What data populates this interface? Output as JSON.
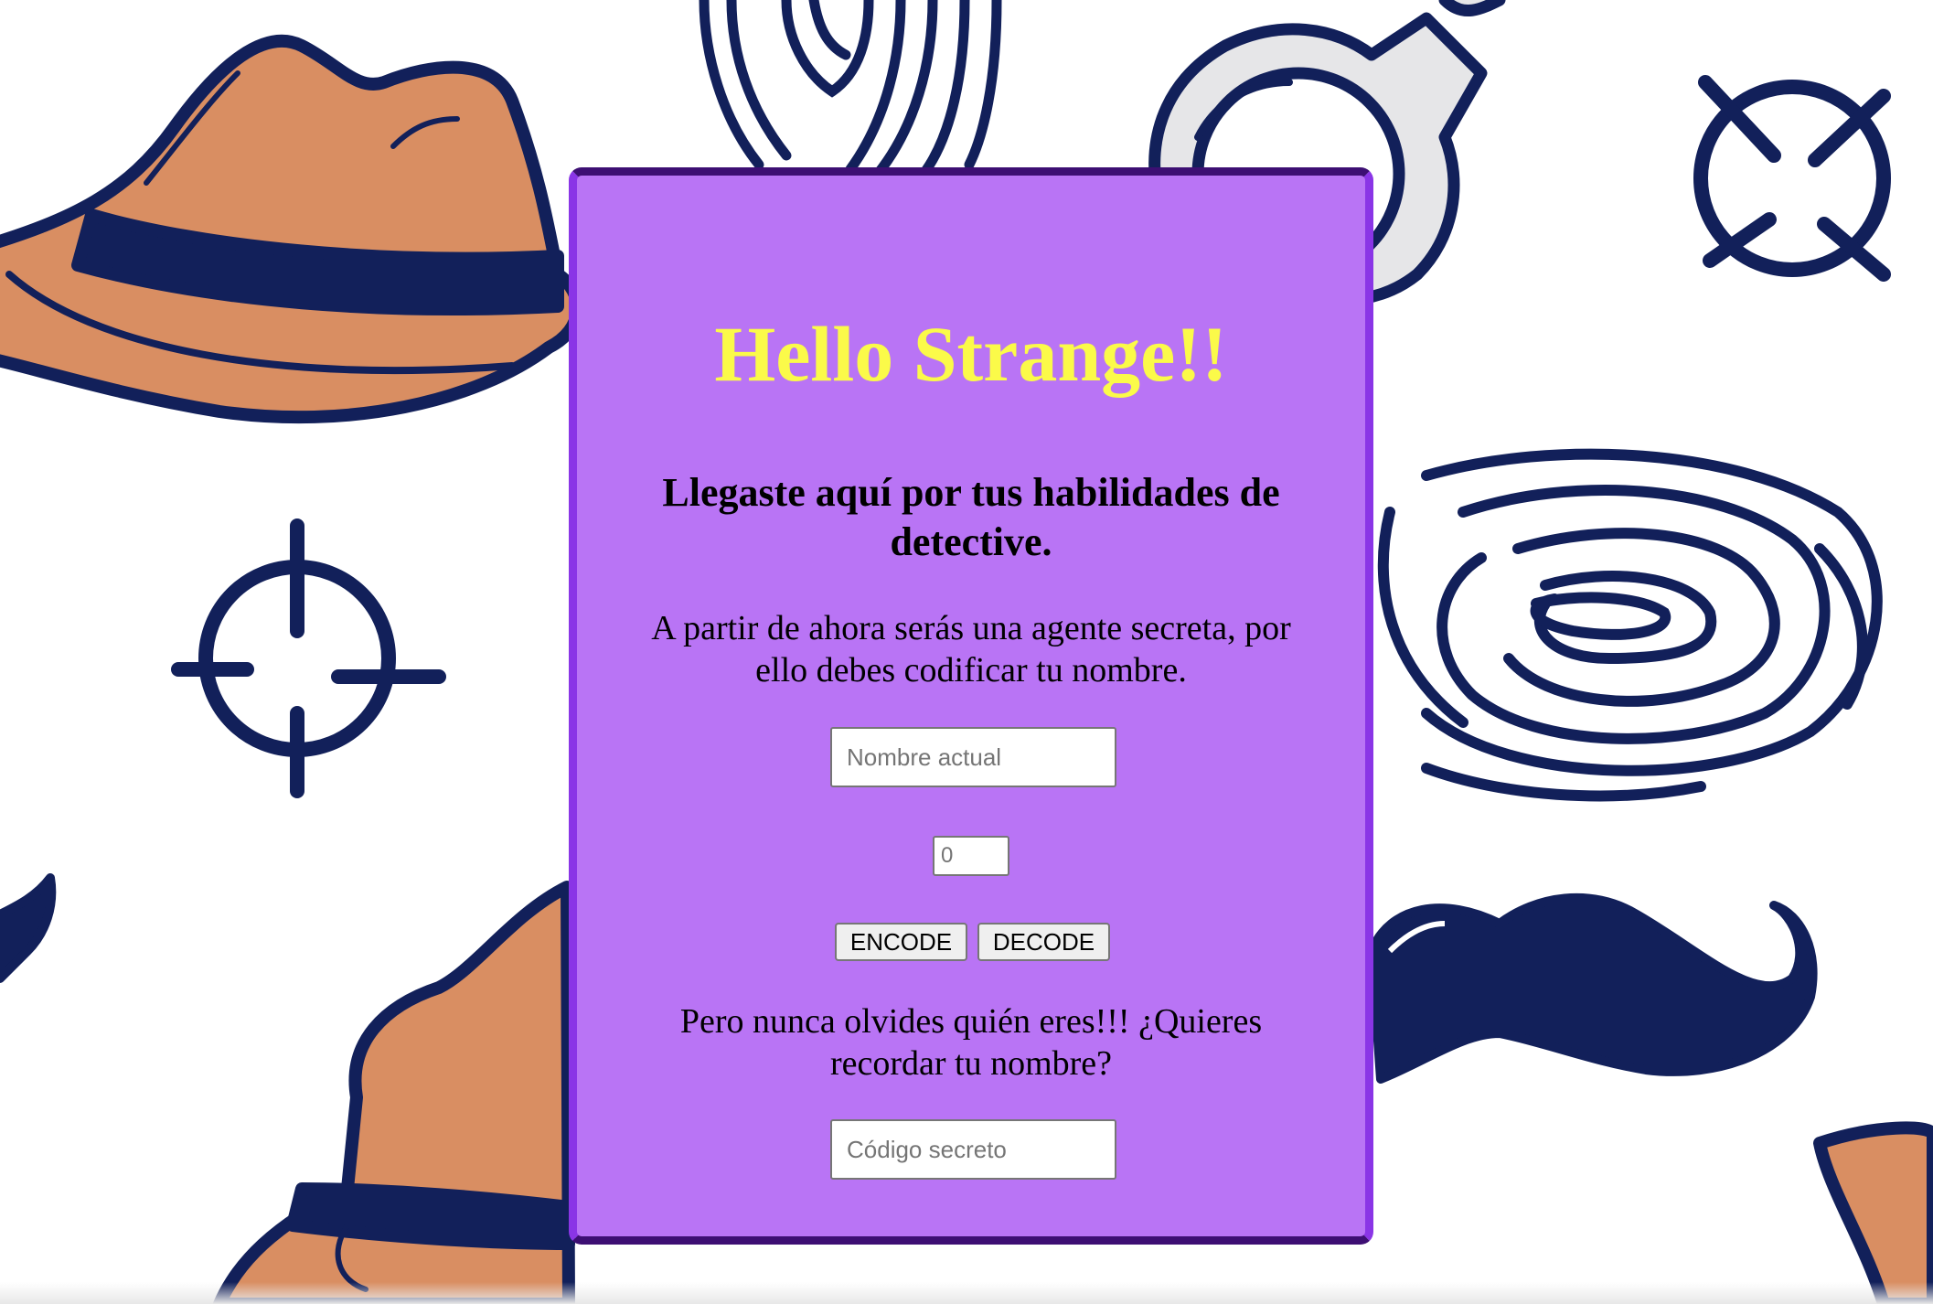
{
  "card": {
    "title": "Hello Strange!!",
    "subtitle": "Llegaste aquí por tus habilidades de detective.",
    "intro": "A partir de ahora serás una agente secreta, por ello debes codificar tu nombre.",
    "name_input": {
      "placeholder": "Nombre actual",
      "value": ""
    },
    "offset_input": {
      "placeholder": "0",
      "value": ""
    },
    "encode_label": "ENCODE",
    "decode_label": "DECODE",
    "reminder": "Pero nunca olvides quién eres!!! ¿Quieres recordar tu nombre?",
    "code_input": {
      "placeholder": "Código secreto",
      "value": ""
    }
  },
  "colors": {
    "card_background": "#b974f5",
    "card_border": "#8a35e6",
    "card_border_dark": "#3d0f73",
    "title": "#fbfa49",
    "doodle_navy": "#12205a",
    "doodle_orange": "#d98e62",
    "doodle_grey": "#e6e6e8"
  },
  "background_icons": [
    "fedora-hat-icon",
    "fingerprint-icon",
    "handcuffs-icon",
    "crosshair-icon",
    "mustache-icon"
  ]
}
